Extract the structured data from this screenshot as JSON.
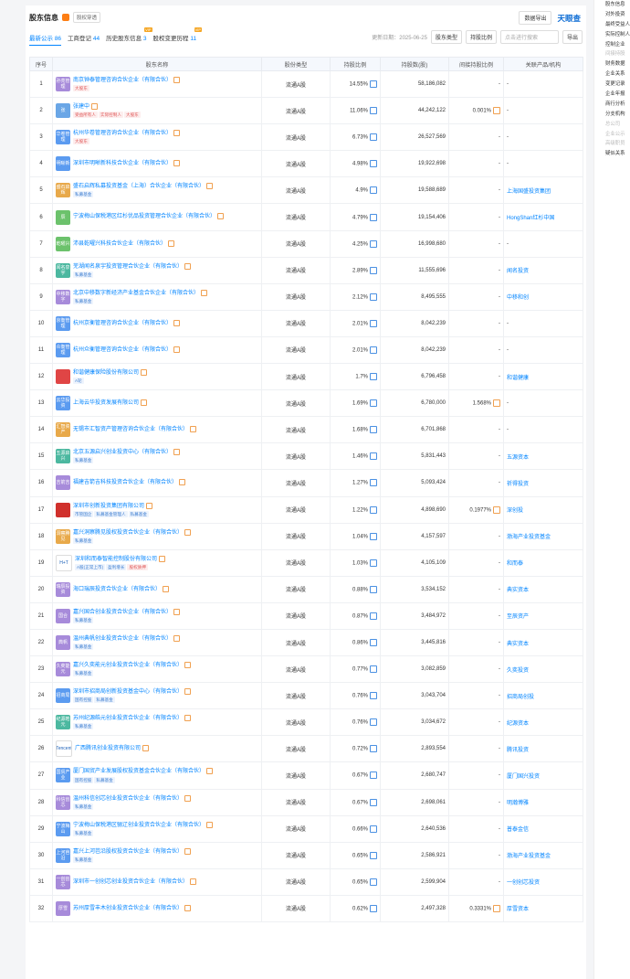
{
  "header": {
    "title": "股东信息",
    "tag": "股权穿透",
    "download": "数据导出",
    "logo": "天眼查"
  },
  "tabs": [
    {
      "label": "最新公示",
      "count": "86"
    },
    {
      "label": "工商登记",
      "count": "44"
    },
    {
      "label": "历史股东信息",
      "count": "3"
    },
    {
      "label": "股权变更历程",
      "count": "11"
    }
  ],
  "tools": {
    "date": "更新日期：2025-06-25",
    "type": "股东类型",
    "ratio": "持股比例",
    "search": "点击进行搜索",
    "export": "导出"
  },
  "columns": [
    "序号",
    "股东名称",
    "股份类型",
    "持股比例",
    "持股数(股)",
    "间接持股比例",
    "关联产品/机构"
  ],
  "rows": [
    {
      "no": "1",
      "avatar": "孙亮管理",
      "color": "#a78bda",
      "name": "南京钟泰管理咨询合伙企业（有限合伙）",
      "tags": [
        {
          "t": "大股东",
          "red": true
        }
      ],
      "type": "流通A股",
      "ratio": "14.55%",
      "shares": "58,186,082",
      "indirect": "-",
      "related": "-"
    },
    {
      "no": "2",
      "avatar": "张",
      "color": "#6aa6e6",
      "name": "张建中",
      "tags": [
        {
          "t": "受益所有人",
          "red": true
        },
        {
          "t": "实际控制人",
          "red": true
        },
        {
          "t": "大股东",
          "red": true
        }
      ],
      "type": "流通A股",
      "ratio": "11.06%",
      "shares": "44,242,122",
      "indirect": "0.001%",
      "related": "-"
    },
    {
      "no": "3",
      "avatar": "华卷管理",
      "color": "#5b9bf0",
      "name": "杭州华卷管理咨询合伙企业（有限合伙）",
      "tags": [
        {
          "t": "大股东",
          "red": true
        }
      ],
      "type": "流通A股",
      "ratio": "6.73%",
      "shares": "26,527,569",
      "indirect": "-",
      "related": "-"
    },
    {
      "no": "4",
      "avatar": "明晰新",
      "color": "#5b9bf0",
      "name": "深圳市明晰新科技合伙企业（有限合伙）",
      "tags": [],
      "type": "流通A股",
      "ratio": "4.98%",
      "shares": "19,922,698",
      "indirect": "-",
      "related": "-"
    },
    {
      "no": "5",
      "avatar": "盛石启辉",
      "color": "#e8a94a",
      "name": "盛石启辉私募投资基金（上海）合伙企业（有限合伙）",
      "tags": [
        {
          "t": "私募基金",
          "red": false
        }
      ],
      "type": "流通A股",
      "ratio": "4.9%",
      "shares": "19,588,689",
      "indirect": "-",
      "related": "上海国盛投资集团"
    },
    {
      "no": "6",
      "avatar": "辰",
      "color": "#6cc26c",
      "name": "宁波梅山保税港区红杉优品投资管理合伙企业（有限合伙）",
      "tags": [],
      "type": "流通A股",
      "ratio": "4.79%",
      "shares": "19,154,406",
      "indirect": "-",
      "related": "HongShan红杉中国"
    },
    {
      "no": "7",
      "avatar": "乾曜兴",
      "color": "#6cc26c",
      "name": "沛县乾曜兴科技合伙企业（有限合伙）",
      "tags": [],
      "type": "流通A股",
      "ratio": "4.25%",
      "shares": "16,998,680",
      "indirect": "-",
      "related": "-"
    },
    {
      "no": "8",
      "avatar": "闻名泉宇",
      "color": "#4cb8a0",
      "name": "芜湖闻名泉宇投资管理合伙企业（有限合伙）",
      "tags": [
        {
          "t": "私募基金",
          "red": false
        }
      ],
      "type": "流通A股",
      "ratio": "2.89%",
      "shares": "11,555,696",
      "indirect": "-",
      "related": "闻名投资"
    },
    {
      "no": "9",
      "avatar": "中移数字",
      "color": "#a78bda",
      "name": "北京中移数字新经济产业基金合伙企业（有限合伙）",
      "tags": [
        {
          "t": "私募基金",
          "red": false
        }
      ],
      "type": "流通A股",
      "ratio": "2.12%",
      "shares": "8,495,555",
      "indirect": "-",
      "related": "中移和创"
    },
    {
      "no": "10",
      "avatar": "京衡管理",
      "color": "#5b9bf0",
      "name": "杭州京衡管理咨询合伙企业（有限合伙）",
      "tags": [],
      "type": "流通A股",
      "ratio": "2.01%",
      "shares": "8,042,239",
      "indirect": "-",
      "related": "-"
    },
    {
      "no": "11",
      "avatar": "众衡管理",
      "color": "#5b9bf0",
      "name": "杭州众衡管理咨询合伙企业（有限合伙）",
      "tags": [],
      "type": "流通A股",
      "ratio": "2.01%",
      "shares": "8,042,239",
      "indirect": "-",
      "related": "-"
    },
    {
      "no": "12",
      "avatar": "",
      "color": "#e04545",
      "name": "和谐健康保险股份有限公司",
      "tags": [
        {
          "t": "A轮",
          "red": false
        }
      ],
      "type": "流通A股",
      "ratio": "1.7%",
      "shares": "6,796,458",
      "indirect": "-",
      "related": "和谐健康"
    },
    {
      "no": "13",
      "avatar": "云华投资",
      "color": "#5b9bf0",
      "name": "上海云华投资发展有限公司",
      "tags": [],
      "type": "流通A股",
      "ratio": "1.69%",
      "shares": "6,780,000",
      "indirect": "1.568%",
      "related": "-"
    },
    {
      "no": "14",
      "avatar": "汇智资产",
      "color": "#e8a94a",
      "name": "无锡市汇智资产管理咨询合伙企业（有限合伙）",
      "tags": [],
      "type": "流通A股",
      "ratio": "1.68%",
      "shares": "6,701,868",
      "indirect": "-",
      "related": "-"
    },
    {
      "no": "15",
      "avatar": "五源启兴",
      "color": "#4cb8a0",
      "name": "北京五源启兴创业投资中心（有限合伙）",
      "tags": [
        {
          "t": "私募基金",
          "red": false
        }
      ],
      "type": "流通A股",
      "ratio": "1.46%",
      "shares": "5,831,443",
      "indirect": "-",
      "related": "五源资本"
    },
    {
      "no": "16",
      "avatar": "吉箭吉",
      "color": "#a78bda",
      "name": "福建吉箭吉科技投资合伙企业（有限合伙）",
      "tags": [],
      "type": "流通A股",
      "ratio": "1.27%",
      "shares": "5,093,424",
      "indirect": "-",
      "related": "祈得投资"
    },
    {
      "no": "17",
      "avatar": "",
      "color": "#d0302c",
      "name": "深圳市创新投资集团有限公司",
      "tags": [
        {
          "t": "市管国企",
          "red": false
        },
        {
          "t": "私募基金管理人",
          "red": false
        },
        {
          "t": "私募基金",
          "red": false
        }
      ],
      "type": "流通A股",
      "ratio": "1.22%",
      "shares": "4,898,690",
      "indirect": "0.1977%",
      "related": "深创投"
    },
    {
      "no": "18",
      "avatar": "洞察腾见",
      "color": "#e8a94a",
      "name": "嘉兴洞察腾见股权投资合伙企业（有限合伙）",
      "tags": [
        {
          "t": "私募基金",
          "red": false
        }
      ],
      "type": "流通A股",
      "ratio": "1.04%",
      "shares": "4,157,597",
      "indirect": "-",
      "related": "渤海产业投资基金"
    },
    {
      "no": "19",
      "avatar": "H+T",
      "color": "#ffffff",
      "name": "深圳和而泰智能控制股份有限公司",
      "tags": [
        {
          "t": "A股(正常上市)",
          "red": false
        },
        {
          "t": "盈利增长",
          "red": false
        },
        {
          "t": "股权质押",
          "red": true
        }
      ],
      "type": "流通A股",
      "ratio": "1.03%",
      "shares": "4,105,109",
      "indirect": "-",
      "related": "和而泰"
    },
    {
      "no": "20",
      "avatar": "瑞辰投资",
      "color": "#a78bda",
      "name": "海口瑞辰投资合伙企业（有限合伙）",
      "tags": [],
      "type": "流通A股",
      "ratio": "0.88%",
      "shares": "3,534,152",
      "indirect": "-",
      "related": "典实资本"
    },
    {
      "no": "21",
      "avatar": "国合",
      "color": "#a78bda",
      "name": "嘉兴国合创业投资合伙企业（有限合伙）",
      "tags": [
        {
          "t": "私募基金",
          "red": false
        }
      ],
      "type": "流通A股",
      "ratio": "0.87%",
      "shares": "3,484,972",
      "indirect": "-",
      "related": "至辰资产"
    },
    {
      "no": "22",
      "avatar": "典帆",
      "color": "#a78bda",
      "name": "温州典帆创业投资合伙企业（有限合伙）",
      "tags": [
        {
          "t": "私募基金",
          "red": false
        }
      ],
      "type": "流通A股",
      "ratio": "0.86%",
      "shares": "3,445,816",
      "indirect": "-",
      "related": "典实资本"
    },
    {
      "no": "23",
      "avatar": "久奕能元",
      "color": "#a78bda",
      "name": "嘉兴久奕能元创业投资合伙企业（有限合伙）",
      "tags": [
        {
          "t": "私募基金",
          "red": false
        }
      ],
      "type": "流通A股",
      "ratio": "0.77%",
      "shares": "3,082,859",
      "indirect": "-",
      "related": "久奕投资"
    },
    {
      "no": "24",
      "avatar": "招商局",
      "color": "#5b9bf0",
      "name": "深圳市招商局创新投资基金中心（有限合伙）",
      "tags": [
        {
          "t": "国有控股",
          "red": false
        },
        {
          "t": "私募基金",
          "red": false
        }
      ],
      "type": "流通A股",
      "ratio": "0.76%",
      "shares": "3,043,704",
      "indirect": "-",
      "related": "招商局创投"
    },
    {
      "no": "25",
      "avatar": "纪源皓元",
      "color": "#4cb8a0",
      "name": "苏州纪源皓元创业投资合伙企业（有限合伙）",
      "tags": [
        {
          "t": "私募基金",
          "red": false
        }
      ],
      "type": "流通A股",
      "ratio": "0.76%",
      "shares": "3,034,672",
      "indirect": "-",
      "related": "纪源资本"
    },
    {
      "no": "26",
      "avatar": "Tencent",
      "color": "#ffffff",
      "name": "广西腾讯创业投资有限公司",
      "tags": [],
      "type": "流通A股",
      "ratio": "0.72%",
      "shares": "2,893,554",
      "indirect": "-",
      "related": "腾讯投资"
    },
    {
      "no": "27",
      "avatar": "国贸产业",
      "color": "#5b9bf0",
      "name": "厦门国贸产业发展股权投资基金合伙企业（有限合伙）",
      "tags": [
        {
          "t": "国有控股",
          "red": false
        },
        {
          "t": "私募基金",
          "red": false
        }
      ],
      "type": "流通A股",
      "ratio": "0.67%",
      "shares": "2,680,747",
      "indirect": "-",
      "related": "厦门国兴投资"
    },
    {
      "no": "28",
      "avatar": "科信创芯",
      "color": "#a78bda",
      "name": "温州科信创芯创业投资合伙企业（有限合伙）",
      "tags": [
        {
          "t": "私募基金",
          "red": false
        }
      ],
      "type": "流通A股",
      "ratio": "0.67%",
      "shares": "2,698,061",
      "indirect": "-",
      "related": "明瀚博雅"
    },
    {
      "no": "29",
      "avatar": "宁波梅山",
      "color": "#5b9bf0",
      "name": "宁波梅山保税港区骊辽创业投资合伙企业（有限合伙）",
      "tags": [
        {
          "t": "私募基金",
          "red": false
        }
      ],
      "type": "流通A股",
      "ratio": "0.66%",
      "shares": "2,640,536",
      "indirect": "-",
      "related": "普泰金信"
    },
    {
      "no": "30",
      "avatar": "上河芭沿",
      "color": "#5b9bf0",
      "name": "嘉兴上河芭沿股权投资合伙企业（有限合伙）",
      "tags": [
        {
          "t": "私募基金",
          "red": false
        }
      ],
      "type": "流通A股",
      "ratio": "0.65%",
      "shares": "2,586,921",
      "indirect": "-",
      "related": "渤海产业投资基金"
    },
    {
      "no": "31",
      "avatar": "一创创芯",
      "color": "#a78bda",
      "name": "深圳市一创创芯创业投资合伙企业（有限合伙）",
      "tags": [],
      "type": "流通A股",
      "ratio": "0.65%",
      "shares": "2,599,904",
      "indirect": "-",
      "related": "一创创芯投资"
    },
    {
      "no": "32",
      "avatar": "厚雪",
      "color": "#a78bda",
      "name": "苏州厚雪丰木创业投资合伙企业（有限合伙）",
      "tags": [],
      "type": "流通A股",
      "ratio": "0.62%",
      "shares": "2,497,328",
      "indirect": "0.3331%",
      "related": "厚雪资本"
    }
  ],
  "rightnav": [
    {
      "t": "股东信息",
      "dim": false
    },
    {
      "t": "对外投资",
      "dim": false
    },
    {
      "t": "最终受益人",
      "dim": false
    },
    {
      "t": "实际控制人",
      "dim": false
    },
    {
      "t": "控制企业",
      "dim": false
    },
    {
      "t": "间接持股",
      "dim": true
    },
    {
      "t": "财务数据",
      "dim": false
    },
    {
      "t": "企业关系",
      "dim": false
    },
    {
      "t": "变更记录",
      "dim": false
    },
    {
      "t": "企业年报",
      "dim": false
    },
    {
      "t": "商行分析",
      "dim": false
    },
    {
      "t": "分支机构",
      "dim": false
    },
    {
      "t": "总公司",
      "dim": true
    },
    {
      "t": "企业公示",
      "dim": true
    },
    {
      "t": "高级职员",
      "dim": true
    },
    {
      "t": "疑似关系",
      "dim": false
    }
  ]
}
